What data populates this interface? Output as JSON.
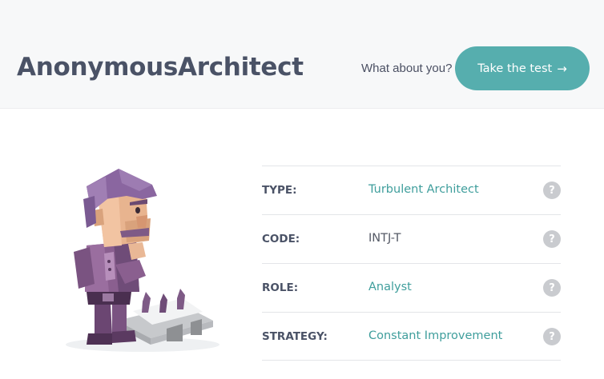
{
  "header": {
    "username": "AnonymousArchitect",
    "prompt": "What about you?",
    "cta_label": "Take the test",
    "cta_arrow": "→"
  },
  "profile": {
    "rows": [
      {
        "label": "TYPE:",
        "value": "Turbulent Architect",
        "value_linked": true,
        "help": "?"
      },
      {
        "label": "CODE:",
        "value": "INTJ-T",
        "value_linked": false,
        "help": "?"
      },
      {
        "label": "ROLE:",
        "value": "Analyst",
        "value_linked": true,
        "help": "?"
      },
      {
        "label": "STRATEGY:",
        "value": "Constant Improvement",
        "value_linked": true,
        "help": "?"
      }
    ]
  },
  "colors": {
    "accent": "#56aeae",
    "link": "#3f9e9c",
    "header_bg": "#f7f8f9",
    "help_bg": "#c9cbcf",
    "figure_purple": "#8a5f8f"
  },
  "icons": {
    "cta": "arrow-right-icon",
    "help": "question-mark-icon",
    "figure": "architect-avatar-illustration"
  }
}
